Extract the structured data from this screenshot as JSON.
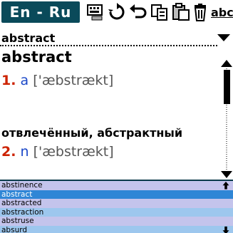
{
  "toolbar": {
    "language_pair": "En - Ru",
    "tools": [
      {
        "icon": "keyboard-icon"
      },
      {
        "icon": "refresh-icon"
      },
      {
        "icon": "undo-icon"
      },
      {
        "icon": "copy-icon"
      },
      {
        "icon": "paste-icon"
      },
      {
        "icon": "trash-icon"
      }
    ],
    "mode_label": "abc"
  },
  "search": {
    "value": "abstract"
  },
  "article": {
    "headword": "abstract",
    "senses": [
      {
        "number": "1.",
        "pos": "a",
        "transcription": "['æbstrækt]"
      },
      {
        "number": "2.",
        "pos": "n",
        "transcription": "['æbstrækt]"
      }
    ],
    "meaning": "отвлечённый, абстрактный"
  },
  "word_list": {
    "items": [
      "abstinence",
      "abstract",
      "abstracted",
      "abstraction",
      "abstruse",
      "absurd"
    ],
    "selected_index": 1
  },
  "colors": {
    "header_bg": "#0a4a5a",
    "sense_number": "#cc2200",
    "part_of_speech": "#1b48c8",
    "selection": "#2f86d6",
    "row_lavender": "#c4c4ec",
    "row_blue": "#9dc7ee"
  }
}
